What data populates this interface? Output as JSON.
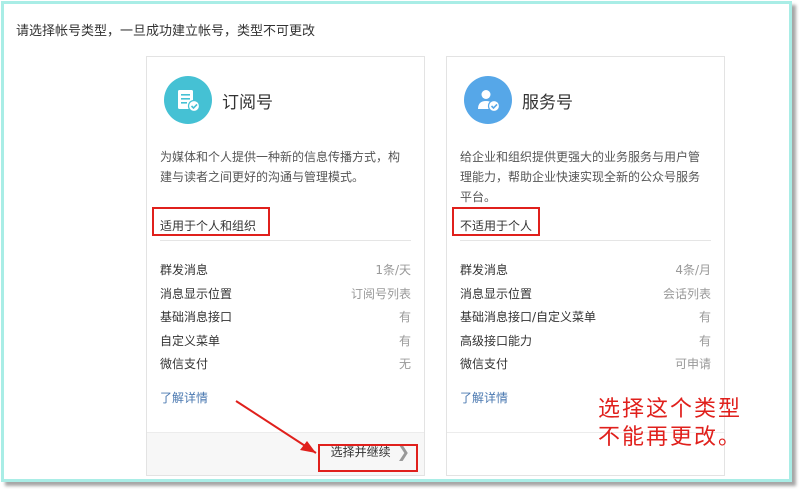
{
  "intro_text": "请选择帐号类型，一旦成功建立帐号，类型不可更改",
  "accent_color": "#e0201c",
  "cards": [
    {
      "title": "订阅号",
      "icon": "document-check-icon",
      "icon_color": "#45c1d4",
      "description": "为媒体和个人提供一种新的信息传播方式，构建与读者之间更好的沟通与管理模式。",
      "scope": "适用于个人和组织",
      "features": [
        {
          "label": "群发消息",
          "value": "1条/天"
        },
        {
          "label": "消息显示位置",
          "value": "订阅号列表"
        },
        {
          "label": "基础消息接口",
          "value": "有"
        },
        {
          "label": "自定义菜单",
          "value": "有"
        },
        {
          "label": "微信支付",
          "value": "无"
        }
      ],
      "more_link": "了解详情",
      "action_label": "选择并继续"
    },
    {
      "title": "服务号",
      "icon": "user-check-icon",
      "icon_color": "#56a7e8",
      "description": "给企业和组织提供更强大的业务服务与用户管理能力，帮助企业快速实现全新的公众号服务平台。",
      "scope": "不适用于个人",
      "features": [
        {
          "label": "群发消息",
          "value": "4条/月"
        },
        {
          "label": "消息显示位置",
          "value": "会话列表"
        },
        {
          "label": "基础消息接口/自定义菜单",
          "value": "有"
        },
        {
          "label": "高级接口能力",
          "value": "有"
        },
        {
          "label": "微信支付",
          "value": "可申请"
        }
      ],
      "more_link": "了解详情"
    }
  ],
  "annotation_lines": [
    "选择这个类型",
    "不能再更改。"
  ]
}
